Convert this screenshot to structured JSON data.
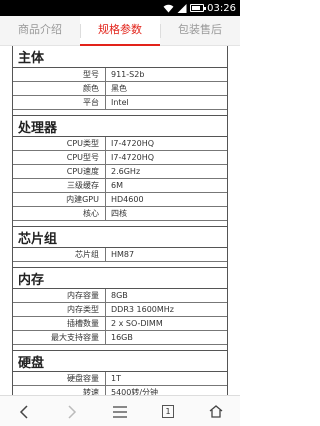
{
  "status_bar": {
    "time": "03:26",
    "battery_level": 0.8
  },
  "tabs": [
    {
      "label": "商品介绍",
      "active": false
    },
    {
      "label": "规格参数",
      "active": true
    },
    {
      "label": "包装售后",
      "active": false
    }
  ],
  "accent_color": "#e2231a",
  "sections": [
    {
      "title": "主体",
      "rows": [
        {
          "label": "型号",
          "value": "911-S2b"
        },
        {
          "label": "颜色",
          "value": "黑色"
        },
        {
          "label": "平台",
          "value": "Intel"
        }
      ]
    },
    {
      "title": "处理器",
      "rows": [
        {
          "label": "CPU类型",
          "value": "I7-4720HQ"
        },
        {
          "label": "CPU型号",
          "value": "I7-4720HQ"
        },
        {
          "label": "CPU速度",
          "value": "2.6GHz"
        },
        {
          "label": "三级缓存",
          "value": "6M"
        },
        {
          "label": "内建GPU",
          "value": "HD4600"
        },
        {
          "label": "核心",
          "value": "四核"
        }
      ]
    },
    {
      "title": "芯片组",
      "rows": [
        {
          "label": "芯片组",
          "value": "HM87"
        }
      ]
    },
    {
      "title": "内存",
      "rows": [
        {
          "label": "内存容量",
          "value": "8GB"
        },
        {
          "label": "内存类型",
          "value": "DDR3 1600MHz"
        },
        {
          "label": "插槽数量",
          "value": "2 x SO-DIMM"
        },
        {
          "label": "最大支持容量",
          "value": "16GB"
        }
      ]
    },
    {
      "title": "硬盘",
      "rows": [
        {
          "label": "硬盘容量",
          "value": "1T"
        },
        {
          "label": "转速",
          "value": "5400转/分钟"
        }
      ]
    }
  ],
  "bottom_nav": {
    "tab_count": "1",
    "icons": [
      "back-icon",
      "forward-icon",
      "menu-icon",
      "tabs-icon",
      "home-icon"
    ]
  }
}
